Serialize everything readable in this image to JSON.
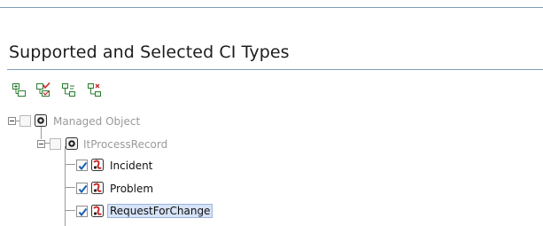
{
  "section": {
    "title": "Supported and Selected CI Types"
  },
  "toolbar": {
    "buttons": [
      {
        "icon": "expand-all-icon"
      },
      {
        "icon": "select-all-icon"
      },
      {
        "icon": "expand-selected-icon"
      },
      {
        "icon": "collapse-selected-icon"
      }
    ]
  },
  "tree": {
    "nodes": [
      {
        "label": "Managed Object",
        "checked": false,
        "enabled": false,
        "expanded": true,
        "icon": "managed-object-icon"
      },
      {
        "label": "ItProcessRecord",
        "checked": false,
        "enabled": false,
        "expanded": true,
        "icon": "managed-object-icon"
      },
      {
        "label": "Incident",
        "checked": true,
        "enabled": true,
        "icon": "ci-type-icon"
      },
      {
        "label": "Problem",
        "checked": true,
        "enabled": true,
        "icon": "ci-type-icon"
      },
      {
        "label": "RequestForChange",
        "checked": true,
        "enabled": true,
        "selected": true,
        "icon": "ci-type-icon"
      }
    ]
  },
  "colors": {
    "rule": "#7f9db9",
    "selection_bg": "#d6e3f8",
    "check": "#1a5fb4",
    "ci_icon_red": "#c62828"
  }
}
